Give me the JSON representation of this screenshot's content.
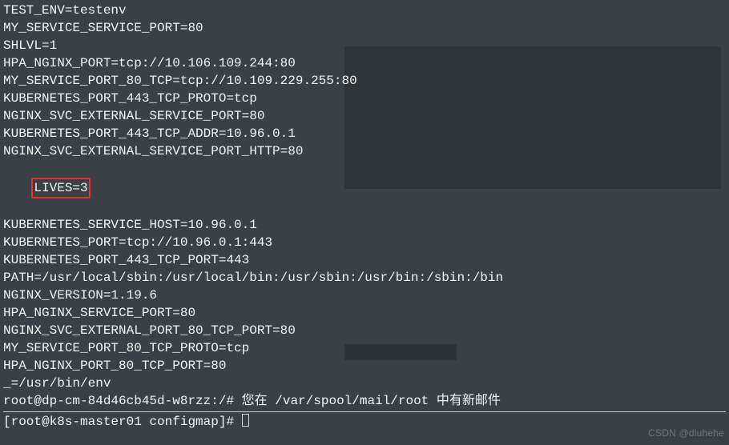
{
  "env": {
    "lines_before": [
      "TEST_ENV=testenv",
      "MY_SERVICE_SERVICE_PORT=80",
      "SHLVL=1",
      "HPA_NGINX_PORT=tcp://10.106.109.244:80",
      "MY_SERVICE_PORT_80_TCP=tcp://10.109.229.255:80",
      "KUBERNETES_PORT_443_TCP_PROTO=tcp",
      "NGINX_SVC_EXTERNAL_SERVICE_PORT=80",
      "KUBERNETES_PORT_443_TCP_ADDR=10.96.0.1",
      "NGINX_SVC_EXTERNAL_SERVICE_PORT_HTTP=80"
    ],
    "highlighted": "LIVES=3",
    "lines_after": [
      "KUBERNETES_SERVICE_HOST=10.96.0.1",
      "KUBERNETES_PORT=tcp://10.96.0.1:443",
      "KUBERNETES_PORT_443_TCP_PORT=443",
      "PATH=/usr/local/sbin:/usr/local/bin:/usr/sbin:/usr/bin:/sbin:/bin",
      "NGINX_VERSION=1.19.6",
      "HPA_NGINX_SERVICE_PORT=80",
      "NGINX_SVC_EXTERNAL_PORT_80_TCP_PORT=80",
      "MY_SERVICE_PORT_80_TCP_PROTO=tcp",
      "HPA_NGINX_PORT_80_TCP_PORT=80",
      "_=/usr/bin/env"
    ]
  },
  "mail_line": "root@dp-cm-84d46cb45d-w8rzz:/# 您在 /var/spool/mail/root 中有新邮件",
  "prompt": "[root@k8s-master01 configmap]# ",
  "watermark": "CSDN @dluhehe"
}
